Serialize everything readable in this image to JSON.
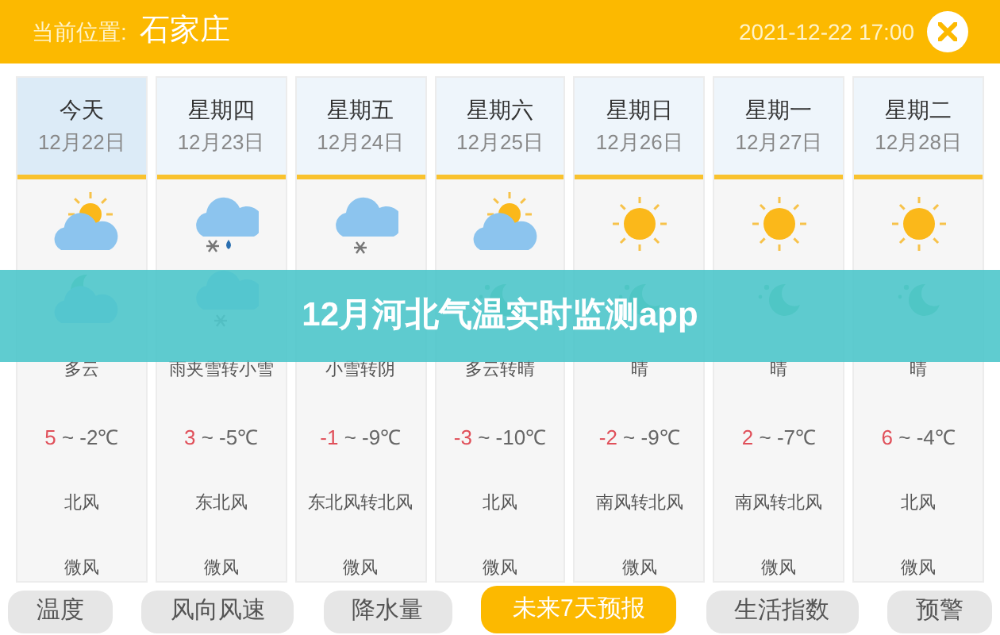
{
  "header": {
    "location_label": "当前位置:",
    "city": "石家庄",
    "datetime": "2021-12-22 17:00"
  },
  "days": [
    {
      "weekday": "今天",
      "date": "12月22日",
      "selected": true,
      "day_icon": {
        "kind": "partly_cloudy"
      },
      "night_icon": {
        "kind": "cloud_moon"
      },
      "condition": "多云",
      "high": "5",
      "separator": "~",
      "low": "-2℃",
      "wind_direction": "北风",
      "wind_force": "微风"
    },
    {
      "weekday": "星期四",
      "date": "12月23日",
      "selected": false,
      "day_icon": {
        "kind": "sleet"
      },
      "night_icon": {
        "kind": "snow"
      },
      "condition": "雨夹雪转小雪",
      "high": "3",
      "separator": "~",
      "low": "-5℃",
      "wind_direction": "东北风",
      "wind_force": "微风"
    },
    {
      "weekday": "星期五",
      "date": "12月24日",
      "selected": false,
      "day_icon": {
        "kind": "snow"
      },
      "condition": "小雪转阴",
      "high": "-1",
      "separator": "~",
      "low": "-9℃",
      "wind_direction": "东北风转北风",
      "wind_force": "微风"
    },
    {
      "weekday": "星期六",
      "date": "12月25日",
      "selected": false,
      "day_icon": {
        "kind": "partly_cloudy"
      },
      "night_icon": {
        "kind": "moon"
      },
      "condition": "多云转晴",
      "high": "-3",
      "separator": "~",
      "low": "-10℃",
      "wind_direction": "北风",
      "wind_force": "微风"
    },
    {
      "weekday": "星期日",
      "date": "12月26日",
      "selected": false,
      "day_icon": {
        "kind": "sunny"
      },
      "night_icon": {
        "kind": "moon"
      },
      "condition": "晴",
      "high": "-2",
      "separator": "~",
      "low": "-9℃",
      "wind_direction": "南风转北风",
      "wind_force": "微风"
    },
    {
      "weekday": "星期一",
      "date": "12月27日",
      "selected": false,
      "day_icon": {
        "kind": "sunny"
      },
      "night_icon": {
        "kind": "moon"
      },
      "condition": "晴",
      "high": "2",
      "separator": "~",
      "low": "-7℃",
      "wind_direction": "南风转北风",
      "wind_force": "微风"
    },
    {
      "weekday": "星期二",
      "date": "12月28日",
      "selected": false,
      "day_icon": {
        "kind": "sunny"
      },
      "night_icon": {
        "kind": "moon"
      },
      "condition": "晴",
      "high": "6",
      "separator": "~",
      "low": "-4℃",
      "wind_direction": "北风",
      "wind_force": "微风"
    }
  ],
  "banner": {
    "title": "12月河北气温实时监测app"
  },
  "tabs": [
    {
      "label": "温度",
      "selected": false
    },
    {
      "label": "风向风速",
      "selected": false
    },
    {
      "label": "降水量",
      "selected": false
    },
    {
      "label": "未来7天预报",
      "selected": true
    },
    {
      "label": "生活指数",
      "selected": false
    },
    {
      "label": "预警",
      "selected": false
    }
  ]
}
